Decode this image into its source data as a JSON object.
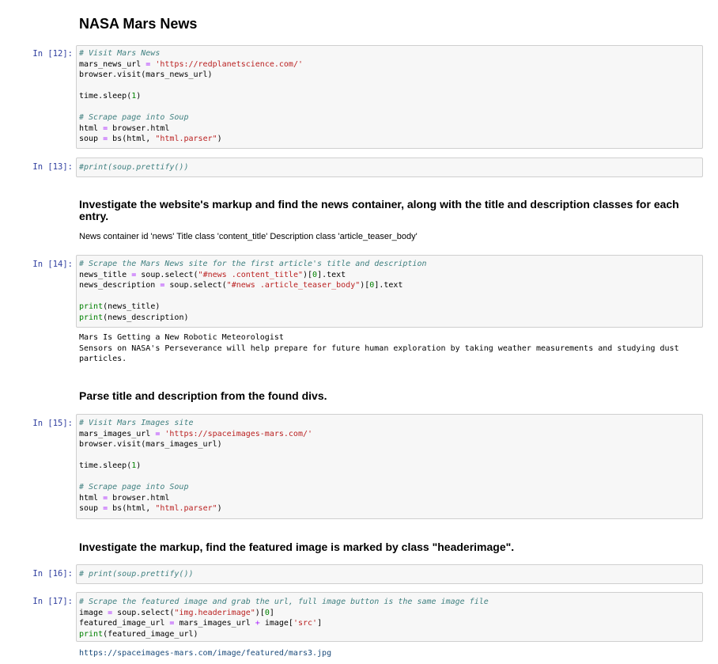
{
  "title": "NASA Mars News",
  "cells": [
    {
      "prompt": "In [12]:",
      "lines": {
        "l1": "# Visit Mars News",
        "l2a": "mars_news_url ",
        "l2b": "=",
        "l2c": " 'https://redplanetscience.com/'",
        "l3": "browser.visit(mars_news_url)",
        "l5a": "time.sleep(",
        "l5b": "1",
        "l5c": ")",
        "l7": "# Scrape page into Soup",
        "l8a": "html ",
        "l8b": "=",
        "l8c": " browser.html",
        "l9a": "soup ",
        "l9b": "=",
        "l9c": " bs(html, ",
        "l9d": "\"html.parser\"",
        "l9e": ")"
      }
    },
    {
      "prompt": "In [13]:",
      "lines": {
        "l1": "#print(soup.prettify())"
      }
    },
    {
      "prompt": "In [14]:",
      "lines": {
        "l1": "# Scrape the Mars News site for the first article's title and description",
        "l2a": "news_title ",
        "l2b": "=",
        "l2c": " soup.select(",
        "l2d": "\"#news .content_title\"",
        "l2e": ")[",
        "l2f": "0",
        "l2g": "].text",
        "l3a": "news_description ",
        "l3b": "=",
        "l3c": " soup.select(",
        "l3d": "\"#news .article_teaser_body\"",
        "l3e": ")[",
        "l3f": "0",
        "l3g": "].text",
        "l5a": "print",
        "l5b": "(news_title)",
        "l6a": "print",
        "l6b": "(news_description)"
      }
    },
    {
      "prompt": "In [15]:",
      "lines": {
        "l1": "# Visit Mars Images site",
        "l2a": "mars_images_url ",
        "l2b": "=",
        "l2c": " 'https://spaceimages-mars.com/'",
        "l3": "browser.visit(mars_images_url)",
        "l5a": "time.sleep(",
        "l5b": "1",
        "l5c": ")",
        "l7": "# Scrape page into Soup",
        "l8a": "html ",
        "l8b": "=",
        "l8c": " browser.html",
        "l9a": "soup ",
        "l9b": "=",
        "l9c": " bs(html, ",
        "l9d": "\"html.parser\"",
        "l9e": ")"
      }
    },
    {
      "prompt": "In [16]:",
      "lines": {
        "l1": "# print(soup.prettify())"
      }
    },
    {
      "prompt": "In [17]:",
      "lines": {
        "l1": "# Scrape the featured image and grab the url, full image button is the same image file",
        "l2a": "image ",
        "l2b": "=",
        "l2c": " soup.select(",
        "l2d": "\"img.headerimage\"",
        "l2e": ")[",
        "l2f": "0",
        "l2g": "]",
        "l3a": "featured_image_url ",
        "l3b": "=",
        "l3c": " mars_images_url ",
        "l3d": "+",
        "l3e": " image[",
        "l3f": "'src'",
        "l3g": "]",
        "l4a": "print",
        "l4b": "(featured_image_url)"
      }
    }
  ],
  "md": {
    "investigate_heading": "Investigate the website's markup and find the news container, along with the title and description classes for each entry.",
    "classes_note": "News container id 'news' Title class 'content_title' Description class 'article_teaser_body'",
    "parse_heading": "Parse title and description from the found divs.",
    "featured_heading": "Investigate the markup, find the featured image is marked by class \"headerimage\"."
  },
  "outputs": {
    "news": "Mars Is Getting a New Robotic Meteorologist\nSensors on NASA's Perseverance will help prepare for future human exploration by taking weather measurements and studying dust\nparticles.",
    "featured_url": "https://spaceimages-mars.com/image/featured/mars3.jpg"
  },
  "colors": {
    "prompt": "#303f9f",
    "comment": "#408080",
    "string": "#ba2121",
    "operator": "#aa22ff",
    "number": "#008000",
    "cell_bg": "#f7f7f7"
  }
}
